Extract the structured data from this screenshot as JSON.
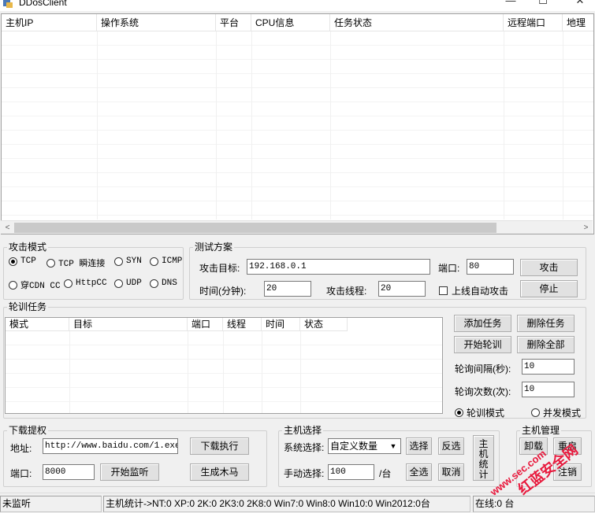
{
  "window": {
    "title": "DDosClient",
    "minimize": "—",
    "maximize": "☐",
    "close": "✕"
  },
  "host_list": {
    "columns": [
      "主机IP",
      "操作系统",
      "平台",
      "CPU信息",
      "任务状态",
      "远程端口",
      "地理"
    ],
    "rows": []
  },
  "attack_mode": {
    "title": "攻击模式",
    "options": [
      "TCP",
      "TCP 瞬连接",
      "SYN",
      "ICMP",
      "穿CDN CC",
      "HttpCC",
      "UDP",
      "DNS"
    ],
    "selected": "TCP"
  },
  "test_plan": {
    "title": "测试方案",
    "target_label": "攻击目标:",
    "target_value": "192.168.0.1",
    "port_label": "端口:",
    "port_value": "80",
    "attack_button": "攻击",
    "time_label": "时间(分钟):",
    "time_value": "20",
    "threads_label": "攻击线程:",
    "threads_value": "20",
    "auto_attack_label": "上线自动攻击",
    "stop_button": "停止"
  },
  "rotation": {
    "title": "轮训任务",
    "columns": [
      "模式",
      "目标",
      "端口",
      "线程",
      "时间",
      "状态"
    ],
    "add_task": "添加任务",
    "delete_task": "删除任务",
    "start_rotation": "开始轮训",
    "delete_all": "删除全部",
    "interval_label": "轮询间隔(秒):",
    "interval_value": "10",
    "count_label": "轮询次数(次):",
    "count_value": "10",
    "mode_rotation": "轮训模式",
    "mode_parallel": "并发模式",
    "selected_mode": "轮训模式"
  },
  "download": {
    "title": "下载提权",
    "url_label": "地址:",
    "url_value": "http://www.baidu.com/1.exe",
    "download_button": "下载执行",
    "port_label": "端口:",
    "port_value": "8000",
    "listen_button": "开始监听",
    "generate_button": "生成木马"
  },
  "host_select": {
    "title": "主机选择",
    "system_label": "系统选择:",
    "system_value": "自定义数量",
    "select_button": "选择",
    "invert_button": "反选",
    "manual_label": "手动选择:",
    "manual_value": "100",
    "unit": "/台",
    "all_button": "全选",
    "cancel_button": "取消",
    "stats_button": "主机统计"
  },
  "host_manage": {
    "title": "主机管理",
    "uninstall": "卸载",
    "restart": "重启",
    "logout": "注销"
  },
  "statusbar": {
    "listen_state": "未监听",
    "stats": "主机统计->NT:0  XP:0  2K:0  2K3:0  2K8:0  Win7:0  Win8:0 Win10:0 Win2012:0台",
    "online": "在线:0 台"
  },
  "watermark": {
    "line1": "www.sec.com",
    "line2": "红蓝安全网"
  },
  "colors": {
    "watermark": "#e8183c",
    "window_bg": "#f0f0f0",
    "scroll_thumb": "#c9c9c9"
  }
}
